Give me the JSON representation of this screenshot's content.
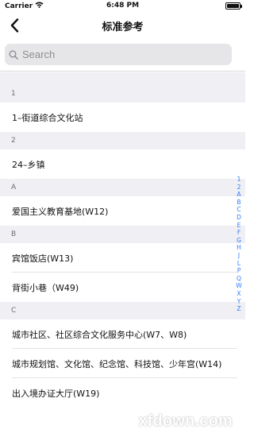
{
  "status_bar": {
    "carrier": "Carrier",
    "time": "6:48 PM"
  },
  "nav": {
    "title": "标准参考"
  },
  "search": {
    "placeholder": "Search"
  },
  "sections": [
    {
      "header": "1",
      "rows": [
        "1–街道综合文化站"
      ]
    },
    {
      "header": "2",
      "rows": [
        "24–乡镇"
      ]
    },
    {
      "header": "A",
      "rows": [
        "爱国主义教育基地(W12)"
      ]
    },
    {
      "header": "B",
      "rows": [
        "宾馆饭店(W13)",
        "背街小巷（W49)"
      ]
    },
    {
      "header": "C",
      "rows": [
        "城市社区、社区综合文化服务中心(W7、W8)",
        "城市规划馆、文化馆、纪念馆、科技馆、少年宫(W14)",
        "出入境办证大厅(W19)"
      ]
    }
  ],
  "index": [
    "1",
    "2",
    "A",
    "B",
    "C",
    "D",
    "E",
    "F",
    "G",
    "H",
    "J",
    "L",
    "P",
    "Q",
    "W",
    "X",
    "Y",
    "Z"
  ],
  "watermark": "xfdown.com"
}
